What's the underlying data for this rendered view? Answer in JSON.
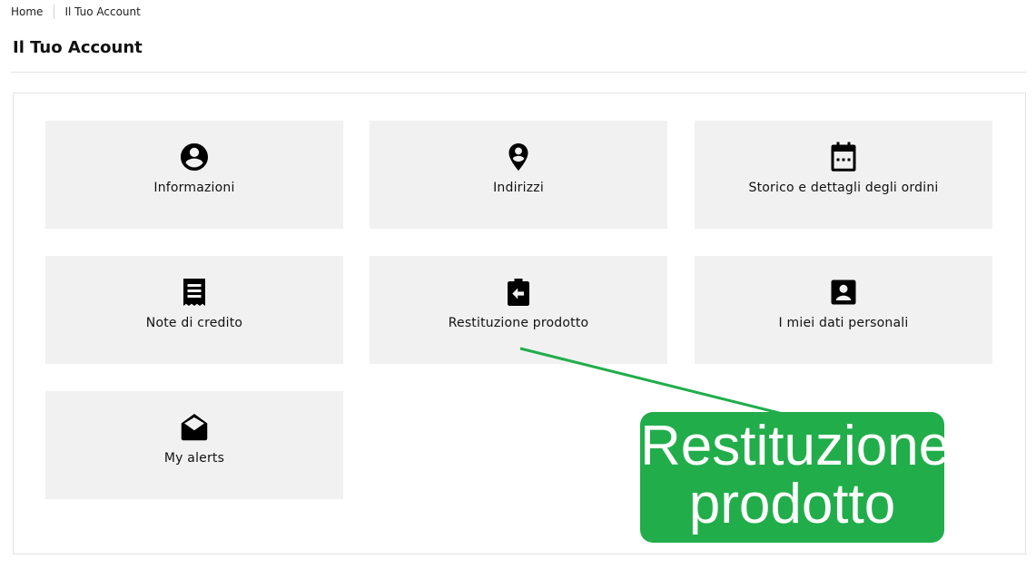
{
  "breadcrumb": {
    "home": "Home",
    "current": "Il Tuo Account"
  },
  "page": {
    "title": "Il Tuo Account"
  },
  "tiles": [
    {
      "label": "Informazioni",
      "icon": "account-circle-icon"
    },
    {
      "label": "Indirizzi",
      "icon": "location-pin-icon"
    },
    {
      "label": "Storico e dettagli degli ordini",
      "icon": "calendar-icon"
    },
    {
      "label": "Note di credito",
      "icon": "receipt-icon"
    },
    {
      "label": "Restituzione prodotto",
      "icon": "clipboard-return-icon"
    },
    {
      "label": "I miei dati personali",
      "icon": "contact-card-icon"
    },
    {
      "label": "My alerts",
      "icon": "open-envelope-icon"
    }
  ],
  "callout": {
    "line1": "Restituzione",
    "line2": "prodotto",
    "color": "#22ad4b"
  },
  "colors": {
    "tile_background": "#f1f1f1",
    "panel_border": "#e3e3e3"
  }
}
